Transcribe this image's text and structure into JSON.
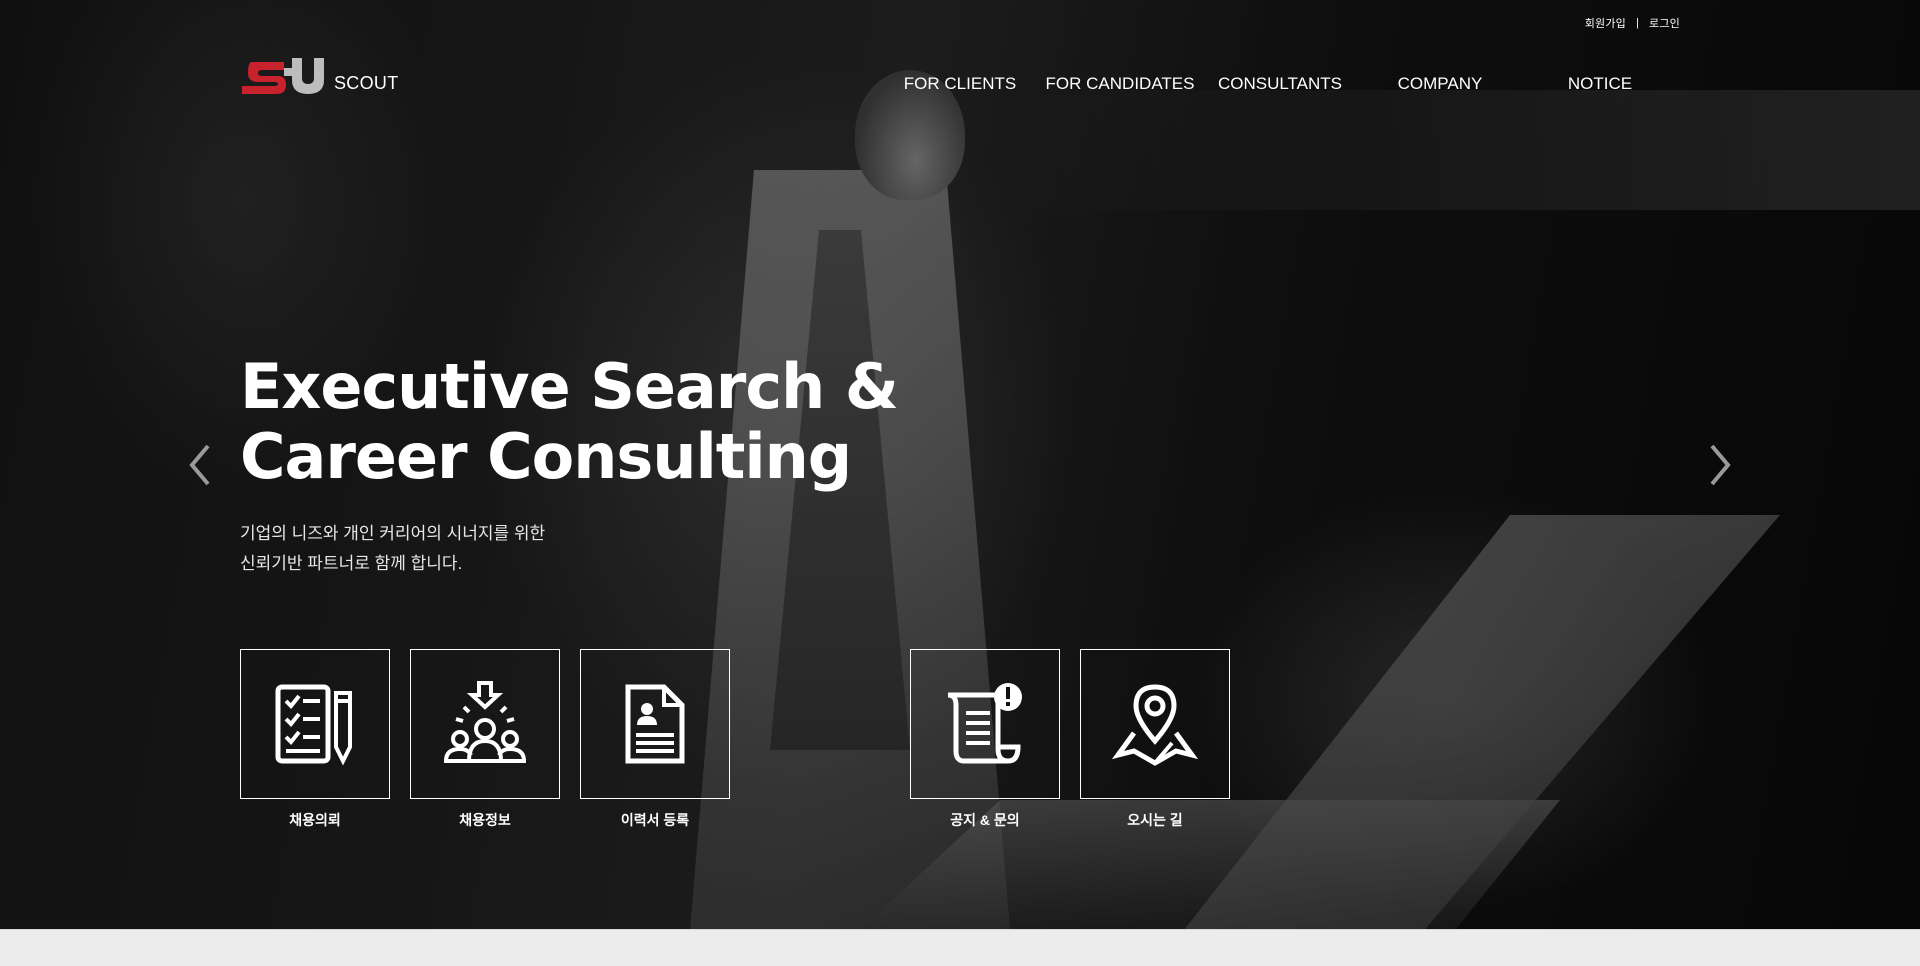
{
  "util_links": {
    "signup": "회원가입",
    "separator": "|",
    "login": "로그인"
  },
  "brand": {
    "logo_text": "SCOUT",
    "accent_color": "#c8232c",
    "logo_secondary_color": "#bdbdbd"
  },
  "nav": {
    "items": [
      {
        "label": "FOR CLIENTS"
      },
      {
        "label": "FOR CANDIDATES"
      },
      {
        "label": "CONSULTANTS"
      },
      {
        "label": "COMPANY"
      },
      {
        "label": "NOTICE"
      }
    ]
  },
  "hero": {
    "title_line1": "Executive Search &",
    "title_line2": "Career Consulting",
    "subtitle_line1": "기업의 니즈와 개인 커리어의 시너지를 위한",
    "subtitle_line2": "신뢰기반 파트너로 함께 합니다.",
    "prev_icon": "chevron-left-icon",
    "next_icon": "chevron-right-icon"
  },
  "quick_links": [
    {
      "label": "채용의뢰",
      "icon": "checklist-pencil-icon"
    },
    {
      "label": "채용정보",
      "icon": "group-download-icon"
    },
    {
      "label": "이력서 등록",
      "icon": "resume-document-icon"
    },
    {
      "label": "공지 & 문의",
      "icon": "scroll-alert-icon"
    },
    {
      "label": "오시는 길",
      "icon": "map-pin-icon"
    }
  ]
}
